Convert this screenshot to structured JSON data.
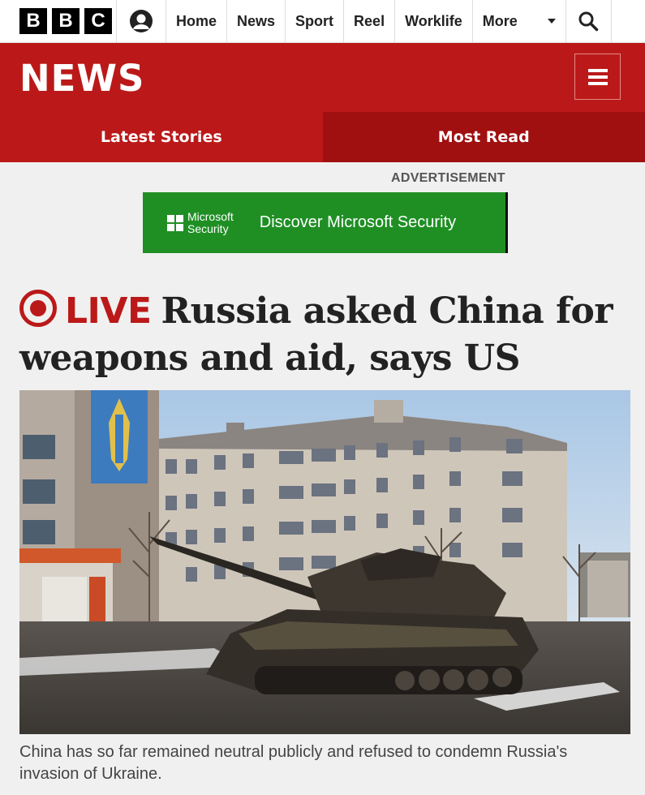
{
  "brand": {
    "letters": [
      "B",
      "B",
      "C"
    ]
  },
  "nav": {
    "items": [
      "Home",
      "News",
      "Sport",
      "Reel",
      "Worklife"
    ],
    "more_label": "More"
  },
  "section": {
    "title": "NEWS",
    "tabs": [
      "Latest Stories",
      "Most Read"
    ]
  },
  "ad": {
    "label": "ADVERTISEMENT",
    "brand_line1": "Microsoft",
    "brand_line2": "Security",
    "text": "Discover Microsoft Security"
  },
  "article": {
    "live_label": "LIVE",
    "headline": "Russia asked China for weapons and aid, says US",
    "caption": "China has so far remained neutral publicly and refused to condemn Russia's invasion of Ukraine."
  },
  "colors": {
    "bbc_red": "#bb1919",
    "most_read_tab": "#a01010",
    "ad_green": "#1f8f24"
  },
  "icons": [
    "account-icon",
    "chevron-down-icon",
    "search-icon",
    "menu-icon",
    "live-icon",
    "microsoft-logo-icon"
  ]
}
